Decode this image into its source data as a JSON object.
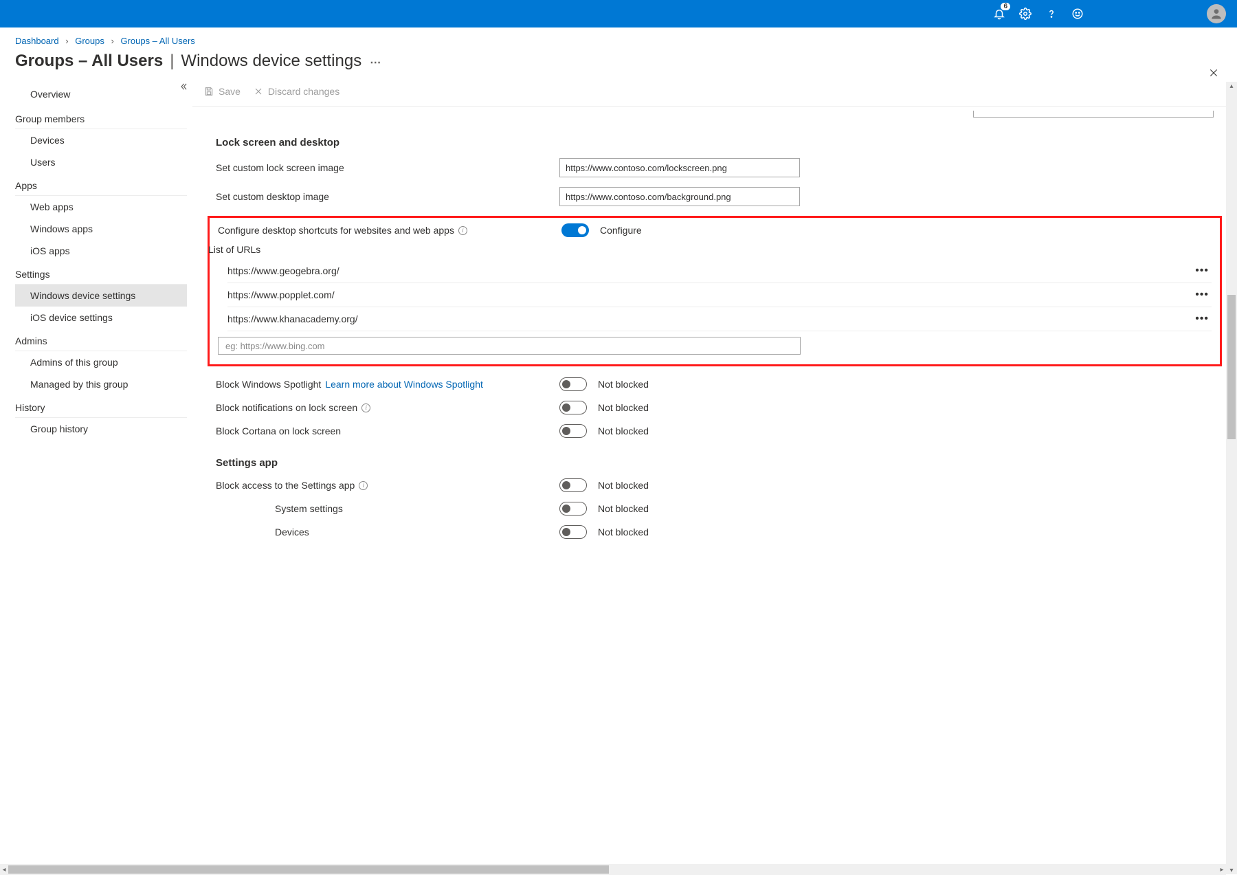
{
  "topbar": {
    "notification_count": "6"
  },
  "breadcrumb": {
    "dashboard": "Dashboard",
    "groups": "Groups",
    "current": "Groups – All Users"
  },
  "title": {
    "group": "Groups – All Users",
    "page": "Windows device settings"
  },
  "commands": {
    "save": "Save",
    "discard": "Discard changes"
  },
  "sidebar": {
    "overview": "Overview",
    "members_head": "Group members",
    "devices": "Devices",
    "users": "Users",
    "apps_head": "Apps",
    "web_apps": "Web apps",
    "windows_apps": "Windows apps",
    "ios_apps": "iOS apps",
    "settings_head": "Settings",
    "windows_settings": "Windows device settings",
    "ios_settings": "iOS device settings",
    "admins_head": "Admins",
    "admins_of": "Admins of this group",
    "managed_by": "Managed by this group",
    "history_head": "History",
    "group_history": "Group history"
  },
  "sections": {
    "lock": "Lock screen and desktop",
    "settings_app": "Settings app"
  },
  "labels": {
    "lock_img": "Set custom lock screen image",
    "desktop_img": "Set custom desktop image",
    "configure_shortcuts": "Configure desktop shortcuts for websites and web apps",
    "list_urls": "List of URLs",
    "url_placeholder": "eg: https://www.bing.com",
    "block_spotlight": "Block Windows Spotlight",
    "spotlight_link": "Learn more about Windows Spotlight",
    "block_notif": "Block notifications on lock screen",
    "block_cortana": "Block Cortana on lock screen",
    "block_settings": "Block access to the Settings app",
    "system_settings": "System settings",
    "devices_settings": "Devices"
  },
  "values": {
    "lock_url": "https://www.contoso.com/lockscreen.png",
    "desktop_url": "https://www.contoso.com/background.png",
    "configure_on": "Configure",
    "not_blocked": "Not blocked"
  },
  "urls": [
    "https://www.geogebra.org/",
    "https://www.popplet.com/",
    "https://www.khanacademy.org/"
  ]
}
